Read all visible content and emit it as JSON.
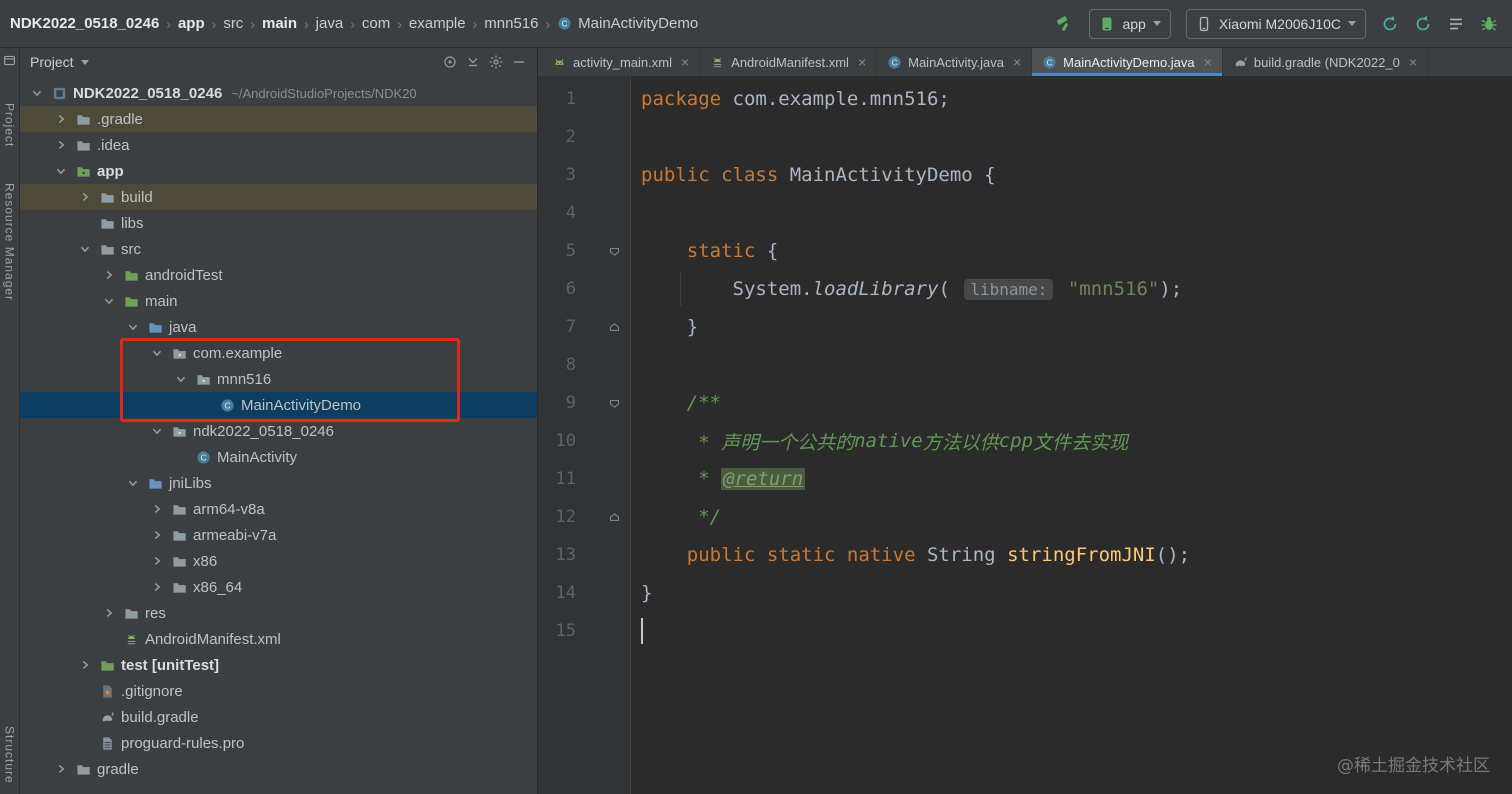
{
  "top_bar": {
    "breadcrumbs": [
      {
        "label": "NDK2022_0518_0246",
        "bold": true
      },
      {
        "label": "app",
        "bold": true
      },
      {
        "label": "src",
        "bold": false
      },
      {
        "label": "main",
        "bold": true
      },
      {
        "label": "java",
        "bold": false
      },
      {
        "label": "com",
        "bold": false
      },
      {
        "label": "example",
        "bold": false
      },
      {
        "label": "mnn516",
        "bold": false
      },
      {
        "label": "MainActivityDemo",
        "bold": false,
        "icon": "class"
      }
    ],
    "run_config": "app",
    "device": "Xiaomi M2006J10C"
  },
  "stripe": {
    "project": "Project",
    "resource_manager": "Resource Manager",
    "structure": "Structure"
  },
  "project_panel": {
    "title": "Project",
    "tree": [
      {
        "label": "NDK2022_0518_0246",
        "sub": "~/AndroidStudioProjects/NDK20",
        "depth": 0,
        "arrow": "down",
        "icon": "project",
        "bold": true
      },
      {
        "label": ".gradle",
        "depth": 1,
        "arrow": "right",
        "icon": "folder",
        "highlight": "olive"
      },
      {
        "label": ".idea",
        "depth": 1,
        "arrow": "right",
        "icon": "folder"
      },
      {
        "label": "app",
        "depth": 1,
        "arrow": "down",
        "icon": "module",
        "bold": true
      },
      {
        "label": "build",
        "depth": 2,
        "arrow": "right",
        "icon": "folder",
        "highlight": "olive"
      },
      {
        "label": "libs",
        "depth": 2,
        "arrow": "none",
        "icon": "folder"
      },
      {
        "label": "src",
        "depth": 2,
        "arrow": "down",
        "icon": "folder"
      },
      {
        "label": "androidTest",
        "depth": 3,
        "arrow": "right",
        "icon": "folder-green"
      },
      {
        "label": "main",
        "depth": 3,
        "arrow": "down",
        "icon": "folder-green"
      },
      {
        "label": "java",
        "depth": 4,
        "arrow": "down",
        "icon": "folder-blue"
      },
      {
        "label": "com.example",
        "depth": 5,
        "arrow": "down",
        "icon": "package"
      },
      {
        "label": "mnn516",
        "depth": 6,
        "arrow": "down",
        "icon": "package"
      },
      {
        "label": "MainActivityDemo",
        "depth": 7,
        "arrow": "none",
        "icon": "class",
        "highlight": "selected"
      },
      {
        "label": "ndk2022_0518_0246",
        "depth": 5,
        "arrow": "down",
        "icon": "package"
      },
      {
        "label": "MainActivity",
        "depth": 6,
        "arrow": "none",
        "icon": "class"
      },
      {
        "label": "jniLibs",
        "depth": 4,
        "arrow": "down",
        "icon": "folder-blue"
      },
      {
        "label": "arm64-v8a",
        "depth": 5,
        "arrow": "right",
        "icon": "folder"
      },
      {
        "label": "armeabi-v7a",
        "depth": 5,
        "arrow": "right",
        "icon": "folder"
      },
      {
        "label": "x86",
        "depth": 5,
        "arrow": "right",
        "icon": "folder"
      },
      {
        "label": "x86_64",
        "depth": 5,
        "arrow": "right",
        "icon": "folder"
      },
      {
        "label": "res",
        "depth": 3,
        "arrow": "right",
        "icon": "folder"
      },
      {
        "label": "AndroidManifest.xml",
        "depth": 3,
        "arrow": "none",
        "icon": "manifest"
      },
      {
        "label": "test [unitTest]",
        "depth": 2,
        "arrow": "right",
        "icon": "folder-green",
        "bold": true
      },
      {
        "label": ".gitignore",
        "depth": 2,
        "arrow": "none",
        "icon": "gitignore"
      },
      {
        "label": "build.gradle",
        "depth": 2,
        "arrow": "none",
        "icon": "gradle"
      },
      {
        "label": "proguard-rules.pro",
        "depth": 2,
        "arrow": "none",
        "icon": "file"
      },
      {
        "label": "gradle",
        "depth": 1,
        "arrow": "right",
        "icon": "folder"
      }
    ]
  },
  "editor": {
    "tabs": [
      {
        "label": "activity_main.xml",
        "icon": "android",
        "active": false
      },
      {
        "label": "AndroidManifest.xml",
        "icon": "manifest",
        "active": false
      },
      {
        "label": "MainActivity.java",
        "icon": "class",
        "active": false
      },
      {
        "label": "MainActivityDemo.java",
        "icon": "class",
        "active": true
      },
      {
        "label": "build.gradle (NDK2022_0",
        "icon": "gradle",
        "active": false
      }
    ],
    "caret_line": 15,
    "folds": {
      "5": "open",
      "7": "close",
      "9": "open",
      "12": "close"
    },
    "lines": [
      [
        [
          "package ",
          "kw"
        ],
        [
          "com.example.mnn516;",
          "pl"
        ]
      ],
      [],
      [
        [
          "public class ",
          "kw"
        ],
        [
          "MainActivityDemo {",
          "pl"
        ]
      ],
      [],
      [
        [
          "    ",
          "pl"
        ],
        [
          "static ",
          "kw"
        ],
        [
          "{",
          "pl"
        ]
      ],
      [
        [
          "        System.",
          "pl"
        ],
        [
          "loadLibrary",
          "it"
        ],
        [
          "( ",
          "pl"
        ],
        [
          "libname:",
          "inlay"
        ],
        [
          " ",
          "pl"
        ],
        [
          "\"mnn516\"",
          "str"
        ],
        [
          ");",
          "pl"
        ]
      ],
      [
        [
          "    }",
          "pl"
        ]
      ],
      [],
      [
        [
          "    ",
          "pl"
        ],
        [
          "/**",
          "cm"
        ]
      ],
      [
        [
          "     * 声明一个公共的",
          "cm"
        ],
        [
          "native",
          "cmi"
        ],
        [
          "方法以供",
          "cm"
        ],
        [
          "cpp",
          "cmi"
        ],
        [
          "文件去实现",
          "cm"
        ]
      ],
      [
        [
          "     * ",
          "cm"
        ],
        [
          "@return",
          "tag"
        ]
      ],
      [
        [
          "     */",
          "cm"
        ]
      ],
      [
        [
          "    ",
          "pl"
        ],
        [
          "public static native ",
          "kw"
        ],
        [
          "String ",
          "pl"
        ],
        [
          "stringFromJNI",
          "md"
        ],
        [
          "();",
          "pl"
        ]
      ],
      [
        [
          "}",
          "pl"
        ]
      ],
      []
    ],
    "watermark": "@稀土掘金技术社区"
  }
}
